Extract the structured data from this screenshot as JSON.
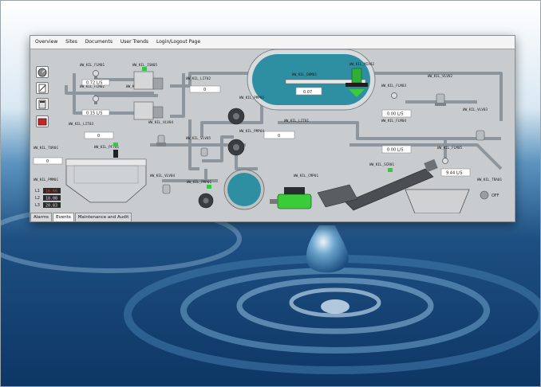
{
  "menu": [
    {
      "label": "Overview"
    },
    {
      "label": "Sites"
    },
    {
      "label": "Documents"
    },
    {
      "label": "User Trends"
    },
    {
      "label": "Login/Logout Page"
    }
  ],
  "tabs": [
    {
      "label": "Alarms"
    },
    {
      "label": "Events"
    },
    {
      "label": "Maintenance and Audit"
    }
  ],
  "side_buttons": [
    {
      "icon": "gauge-icon"
    },
    {
      "icon": "edit-document-icon"
    },
    {
      "icon": "calculator-icon"
    },
    {
      "icon": "red-folder-icon"
    }
  ],
  "tags": {
    "flm01": "WW_KIL_FLM01",
    "isn05": "WW_KIL_ISN05",
    "flm02": "WW_KIL_FLM02",
    "isn02": "WW_KIL_ISN02",
    "lit02": "WW_KIL_LIT02",
    "lit03": "WW_KIL_LIT03",
    "vlv04a": "WW_KIL_VLV04",
    "pft01": "WW_KIL_PFT01",
    "tur01": "WW_KIL_TUR01",
    "pmm01": "WW_KIL_PMM01",
    "dom01": "WW_KIL_DOM01",
    "mix02": "WW_KIL_MIX02",
    "pmp02": "WW_KIL_PMP02",
    "pmp04": "WW_KIL_PMP04",
    "vlv05": "WW_KIL_VLV05",
    "lit01": "WW_KIL_LIT01",
    "flm03": "WW_KIL_FLM03",
    "vlv02": "WW_KIL_VLV02",
    "flm04": "WW_KIL_FLM04",
    "vlv03": "WW_KIL_VLV03",
    "flm05": "WW_KIL_FLM05",
    "scr01": "WW_KIL_SCR01",
    "vlv04b": "WW_KIL_VLV04",
    "pmp01": "WW_KIL_PMP01",
    "cmp01": "WW_KIL_CMP01",
    "tra01": "WW_KIL_TRA01"
  },
  "values": {
    "flm01": "0.72 L/S",
    "flm02": "0.15 L/S",
    "lit03": "0",
    "lit02": "0",
    "tur01": "0",
    "dom01": "0.07",
    "lit01": "0",
    "flm03": "0.00 L/S",
    "flm04": "0.00 L/S",
    "flm05": "9.44 L/S",
    "l1_label": "L1",
    "l1_value": "16.66",
    "l2_label": "L2",
    "l2_value": "18.08",
    "l3_label": "L3",
    "l3_value": "20.83"
  },
  "transporter_state": "OFF",
  "colors": {
    "pipe": "#8d969c",
    "tank_fill": "#2e8fa3",
    "pump_dark": "#3a3d40",
    "motor_green": "#3bcc3b",
    "alarm_red": "#b02020"
  }
}
